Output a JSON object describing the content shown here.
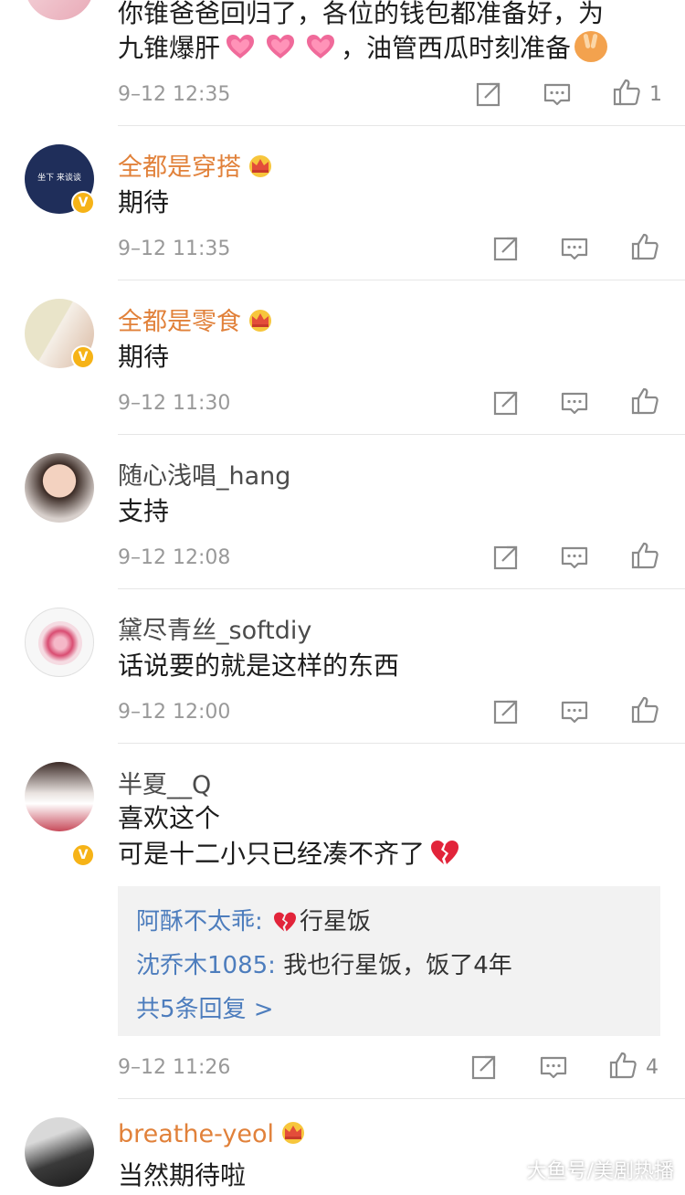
{
  "colors": {
    "vip_name": "#e1813a",
    "link_blue": "#4d7dbd",
    "badge_gold": "#f6b317"
  },
  "comments": [
    {
      "text1": "你锥爸爸回归了，各位的钱包都准备好，为",
      "text2a": "九锥爆肝",
      "text2b": "，油管西瓜时刻准备",
      "time": "9–12 12:35",
      "likes": "1"
    },
    {
      "name": "全都是穿搭",
      "text": "期待",
      "time": "9–12 11:35"
    },
    {
      "name": "全都是零食",
      "text": "期待",
      "time": "9–12 11:30"
    },
    {
      "name": "随心浅唱_hang",
      "text": "支持",
      "time": "9–12 12:08"
    },
    {
      "name": "黛尽青丝_softdiy",
      "text": "话说要的就是这样的东西",
      "time": "9–12 12:00"
    },
    {
      "name": "半夏__Q",
      "text1": "喜欢这个",
      "text2": "可是十二小只已经凑不齐了",
      "replies": [
        {
          "user": "阿酥不太乖",
          "sep": ":",
          "text": "行星饭"
        },
        {
          "user": "沈乔木1085",
          "sep": ":",
          "text": " 我也行星饭，饭了4年"
        }
      ],
      "more": "共5条回复 >",
      "time": "9–12 11:26",
      "likes": "4"
    },
    {
      "name": "breathe-yeol",
      "text": "当然期待啦"
    }
  ],
  "avatar_texts": {
    "avatar2": "坐下 来谈谈"
  },
  "watermark": "大鱼号/美剧热播",
  "icons": [
    "edit-share-icon",
    "comment-icon",
    "like-thumb-icon",
    "crown-icon",
    "heart-icon",
    "broken-heart-icon",
    "verified-badge-icon",
    "peace-hand-emoji-icon"
  ]
}
